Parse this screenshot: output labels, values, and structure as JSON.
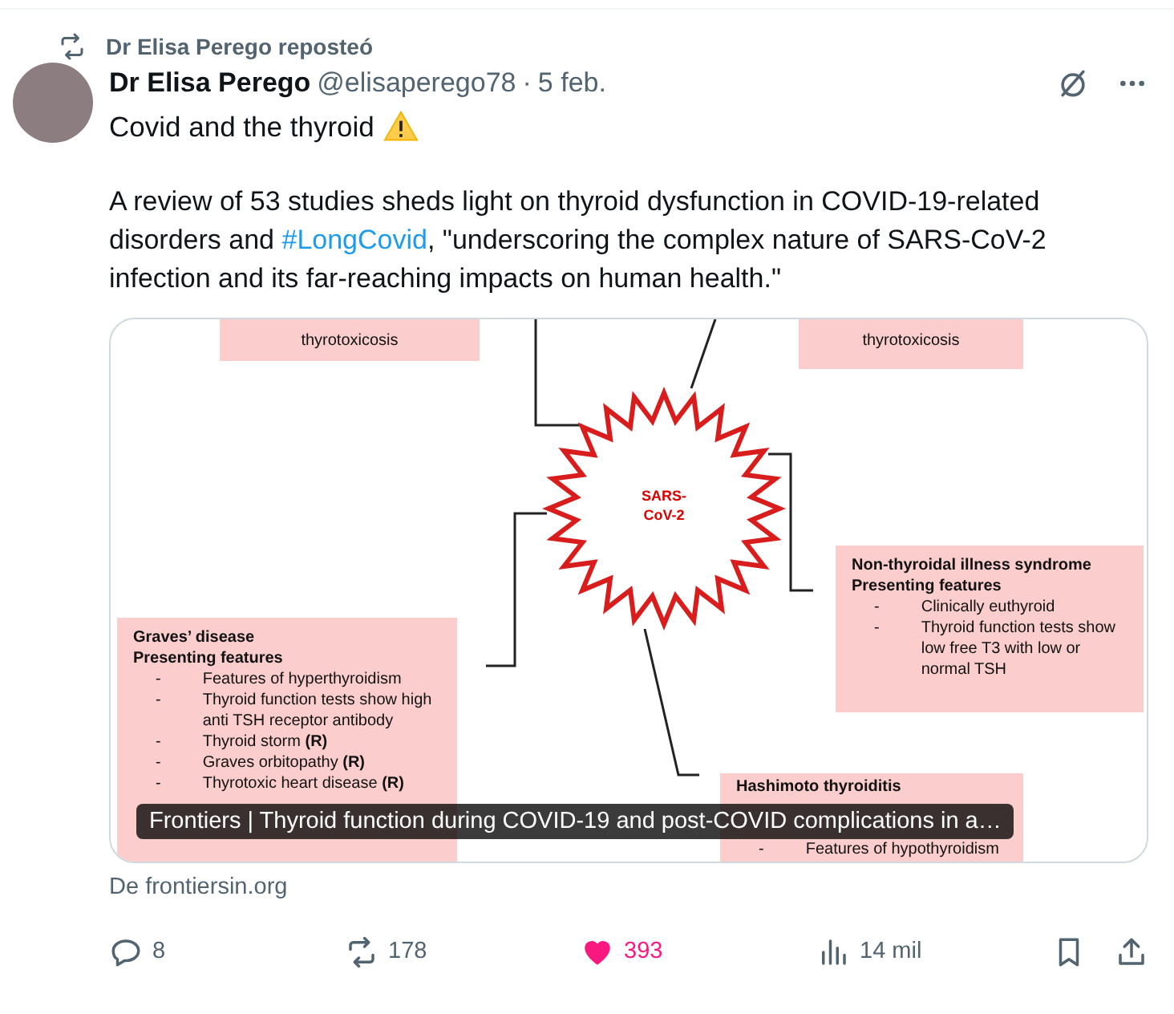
{
  "repost": {
    "label": "Dr Elisa Perego reposteó"
  },
  "post": {
    "author": "Dr Elisa Perego",
    "handle": "@elisaperego78",
    "separator": "·",
    "date": "5 feb.",
    "title": "Covid and the thyroid",
    "body": [
      {
        "kind": "text",
        "text": "A review of 53 studies sheds light on thyroid dysfunction in COVID-19-related disorders and "
      },
      {
        "kind": "hashtag",
        "text": "#LongCovid"
      },
      {
        "kind": "text",
        "text": ", \"underscoring the complex nature of SARS-CoV-2 infection and its far-reaching impacts on human health.\""
      }
    ]
  },
  "card": {
    "figure": {
      "center": "SARS-CoV-2",
      "boxes": [
        {
          "kind": "top-left",
          "lines": [
            "thyrotoxicosis"
          ]
        },
        {
          "kind": "top-right",
          "lines": [
            "thyrotoxicosis"
          ]
        },
        {
          "kind": "right",
          "heading": [
            "Non-thyroidal illness syndrome",
            "Presenting features"
          ],
          "marker": "-",
          "lines": [
            "Clinically euthyroid",
            "Thyroid function tests show low free T3 with low or normal TSH"
          ]
        },
        {
          "kind": "left",
          "heading": [
            "Graves’ disease",
            "Presenting features"
          ],
          "marker": "-",
          "lines": [
            "Features of hyperthyroidism",
            "Thyroid function tests show high anti TSH receptor antibody",
            "Thyroid storm **(R)**",
            "Graves orbitopathy **(R)**",
            "Thyrotoxic heart disease **(R)**"
          ]
        },
        {
          "kind": "bottom",
          "heading": [
            "Hashimoto thyroiditis"
          ],
          "marker": "-",
          "lines": [
            "Features of hypothyroidism"
          ]
        }
      ]
    },
    "caption": "Frontiers | Thyroid function during COVID-19 and post-COVID complications in a…",
    "source": "De frontiersin.org"
  },
  "actions": [
    {
      "kind": "reply",
      "count": "8"
    },
    {
      "kind": "repost",
      "count": "178"
    },
    {
      "kind": "like",
      "count": "393",
      "selected": true
    },
    {
      "kind": "views",
      "count": "14 mil"
    },
    {
      "kind": "bookmark"
    },
    {
      "kind": "share"
    }
  ]
}
